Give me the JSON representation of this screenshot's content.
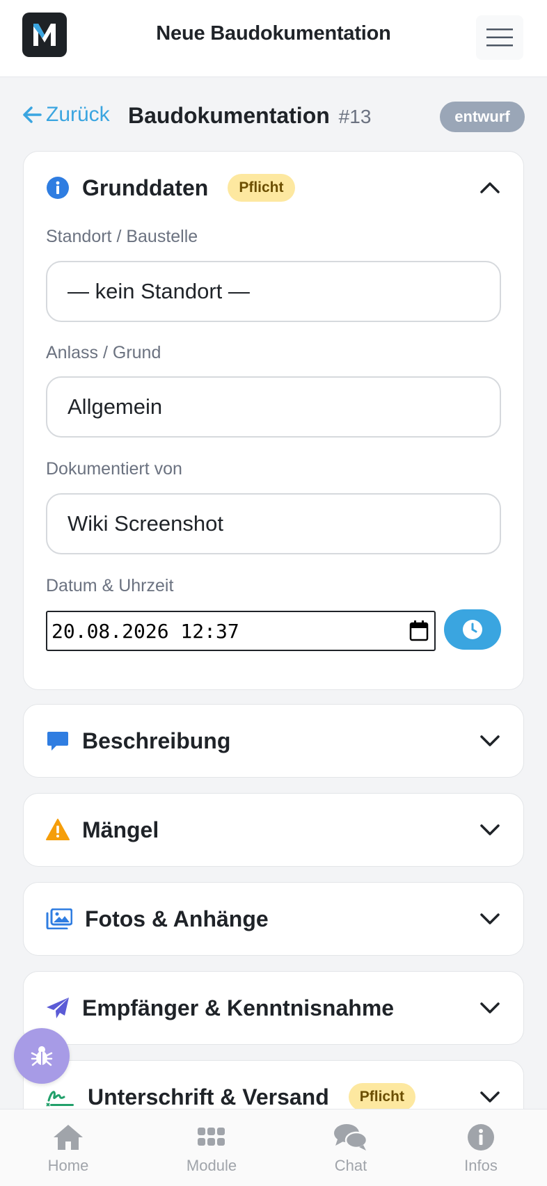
{
  "app": {
    "title": "Neue Baudokumentation",
    "logo_letter": "M"
  },
  "header": {
    "back_label": "Zurück",
    "title": "Baudokumentation",
    "number": "#13",
    "status": "entwurf"
  },
  "sections": {
    "grunddaten": {
      "title": "Grunddaten",
      "badge": "Pflicht",
      "fields": {
        "standort_label": "Standort / Baustelle",
        "standort_value": "— kein Standort —",
        "anlass_label": "Anlass / Grund",
        "anlass_value": "Allgemein",
        "dokumentiert_label": "Dokumentiert von",
        "dokumentiert_value": "Wiki Screenshot",
        "datum_label": "Datum & Uhrzeit",
        "datum_value": "20.08.2026 12:37"
      }
    },
    "beschreibung": {
      "title": "Beschreibung"
    },
    "maengel": {
      "title": "Mängel"
    },
    "fotos": {
      "title": "Fotos & Anhänge"
    },
    "empfaenger": {
      "title": "Empfänger & Kenntnisnahme"
    },
    "unterschrift": {
      "title": "Unterschrift & Versand",
      "badge": "Pflicht"
    }
  },
  "bottom_nav": {
    "home": "Home",
    "module": "Module",
    "chat": "Chat",
    "infos": "Infos"
  },
  "colors": {
    "accent": "#3aa5e0",
    "status_badge": "#9aa6b7",
    "pflicht_badge": "#fde8a0",
    "bug_fab": "#a79be6"
  }
}
